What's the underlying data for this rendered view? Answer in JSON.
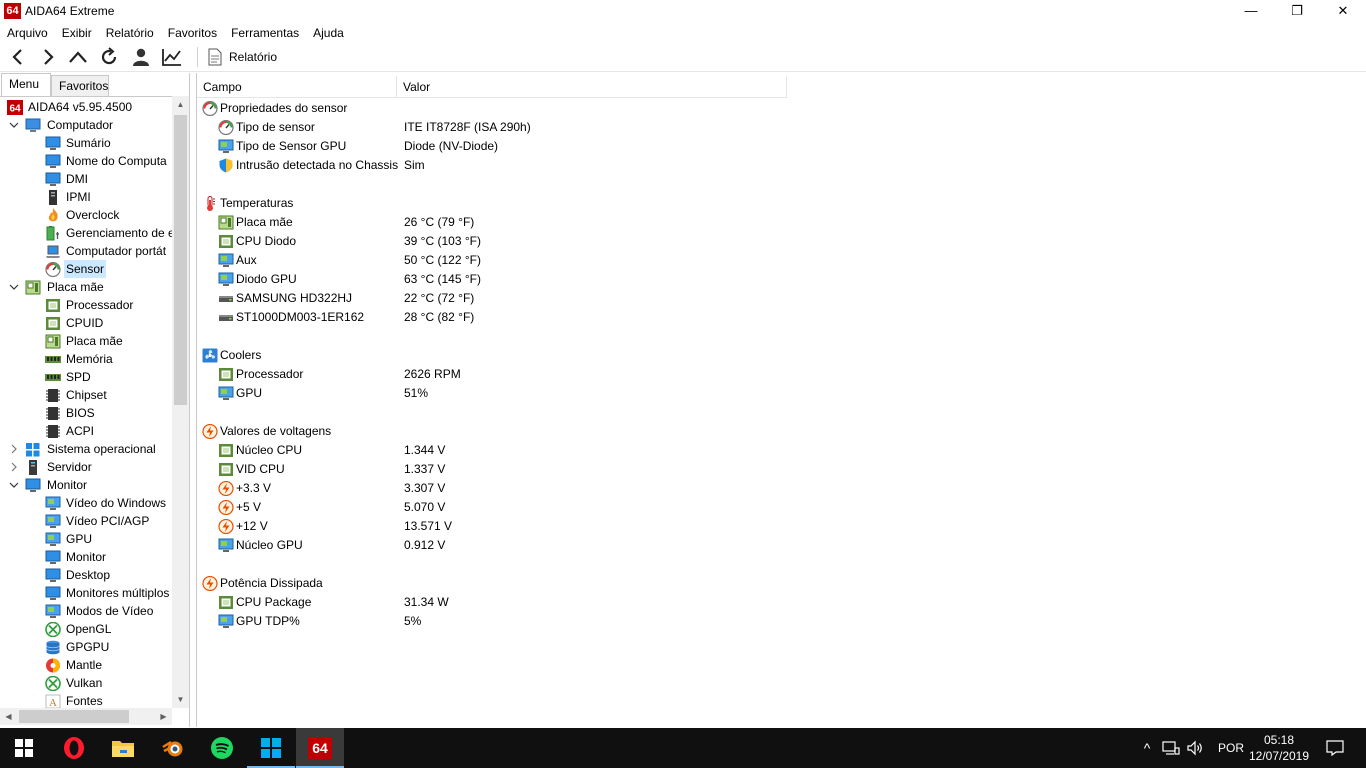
{
  "window": {
    "logo_text": "64",
    "title": "AIDA64 Extreme",
    "minimize": "—",
    "maximize": "❐",
    "close": "✕"
  },
  "menubar": [
    "Arquivo",
    "Exibir",
    "Relatório",
    "Favoritos",
    "Ferramentas",
    "Ajuda"
  ],
  "toolbar": {
    "buttons": [
      "back-icon",
      "forward-icon",
      "up-icon",
      "refresh-icon",
      "user-icon",
      "chart-icon"
    ],
    "report_label": "Relatório"
  },
  "left_tabs": {
    "menu": "Menu",
    "favorites": "Favoritos"
  },
  "tree": [
    {
      "label": "AIDA64 v5.95.4500",
      "level": 0,
      "expander": "",
      "icon": "aida64-icon"
    },
    {
      "label": "Computador",
      "level": 1,
      "expander": "v",
      "icon": "computer-icon"
    },
    {
      "label": "Sumário",
      "level": 2,
      "expander": "",
      "icon": "monitor-icon"
    },
    {
      "label": "Nome do Computa",
      "level": 2,
      "expander": "",
      "icon": "monitor-icon"
    },
    {
      "label": "DMI",
      "level": 2,
      "expander": "",
      "icon": "monitor-icon"
    },
    {
      "label": "IPMI",
      "level": 2,
      "expander": "",
      "icon": "tower-icon"
    },
    {
      "label": "Overclock",
      "level": 2,
      "expander": "",
      "icon": "flame-icon"
    },
    {
      "label": "Gerenciamento de e",
      "level": 2,
      "expander": "",
      "icon": "battery-icon"
    },
    {
      "label": "Computador portát",
      "level": 2,
      "expander": "",
      "icon": "laptop-icon"
    },
    {
      "label": "Sensor",
      "level": 2,
      "expander": "",
      "icon": "sensor-icon",
      "selected": true
    },
    {
      "label": "Placa mãe",
      "level": 1,
      "expander": "v",
      "icon": "motherboard-icon"
    },
    {
      "label": "Processador",
      "level": 2,
      "expander": "",
      "icon": "chip-icon"
    },
    {
      "label": "CPUID",
      "level": 2,
      "expander": "",
      "icon": "chip-icon"
    },
    {
      "label": "Placa mãe",
      "level": 2,
      "expander": "",
      "icon": "motherboard-icon"
    },
    {
      "label": "Memória",
      "level": 2,
      "expander": "",
      "icon": "ram-icon"
    },
    {
      "label": "SPD",
      "level": 2,
      "expander": "",
      "icon": "ram-icon"
    },
    {
      "label": "Chipset",
      "level": 2,
      "expander": "",
      "icon": "ic-icon"
    },
    {
      "label": "BIOS",
      "level": 2,
      "expander": "",
      "icon": "ic-icon"
    },
    {
      "label": "ACPI",
      "level": 2,
      "expander": "",
      "icon": "ic-icon"
    },
    {
      "label": "Sistema operacional",
      "level": 1,
      "expander": ">",
      "icon": "windows-icon"
    },
    {
      "label": "Servidor",
      "level": 1,
      "expander": ">",
      "icon": "server-icon"
    },
    {
      "label": "Monitor",
      "level": 1,
      "expander": "v",
      "icon": "monitor-icon"
    },
    {
      "label": "Vídeo do Windows",
      "level": 2,
      "expander": "",
      "icon": "display-icon"
    },
    {
      "label": "Vídeo PCI/AGP",
      "level": 2,
      "expander": "",
      "icon": "display-icon"
    },
    {
      "label": "GPU",
      "level": 2,
      "expander": "",
      "icon": "display-icon"
    },
    {
      "label": "Monitor",
      "level": 2,
      "expander": "",
      "icon": "monitor-icon"
    },
    {
      "label": "Desktop",
      "level": 2,
      "expander": "",
      "icon": "monitor-icon"
    },
    {
      "label": "Monitores múltiplos",
      "level": 2,
      "expander": "",
      "icon": "monitor-icon"
    },
    {
      "label": "Modos de Vídeo",
      "level": 2,
      "expander": "",
      "icon": "display-icon"
    },
    {
      "label": "OpenGL",
      "level": 2,
      "expander": "",
      "icon": "xbox-icon"
    },
    {
      "label": "GPGPU",
      "level": 2,
      "expander": "",
      "icon": "database-icon"
    },
    {
      "label": "Mantle",
      "level": 2,
      "expander": "",
      "icon": "mantle-icon"
    },
    {
      "label": "Vulkan",
      "level": 2,
      "expander": "",
      "icon": "xbox-icon"
    },
    {
      "label": "Fontes",
      "level": 2,
      "expander": "",
      "icon": "font-icon"
    }
  ],
  "columns": {
    "field": "Campo",
    "value": "Valor"
  },
  "sections": [
    {
      "title": "Propriedades do sensor",
      "icon": "sensor-icon",
      "rows": [
        {
          "field": "Tipo de sensor",
          "value": "ITE IT8728F  (ISA 290h)",
          "icon": "sensor-icon"
        },
        {
          "field": "Tipo de Sensor GPU",
          "value": "Diode  (NV-Diode)",
          "icon": "display-icon"
        },
        {
          "field": "Intrusão detectada no Chassis",
          "value": "Sim",
          "icon": "shield-icon"
        }
      ]
    },
    {
      "title": "Temperaturas",
      "icon": "thermometer-icon",
      "rows": [
        {
          "field": "Placa mãe",
          "value": "26 °C  (79 °F)",
          "icon": "motherboard-icon"
        },
        {
          "field": "CPU Diodo",
          "value": "39 °C  (103 °F)",
          "icon": "chip-icon"
        },
        {
          "field": "Aux",
          "value": "50 °C  (122 °F)",
          "icon": "display-icon"
        },
        {
          "field": "Diodo GPU",
          "value": "63 °C  (145 °F)",
          "icon": "display-icon"
        },
        {
          "field": "SAMSUNG HD322HJ",
          "value": "22 °C  (72 °F)",
          "icon": "hdd-icon"
        },
        {
          "field": "ST1000DM003-1ER162",
          "value": "28 °C  (82 °F)",
          "icon": "hdd-icon"
        }
      ]
    },
    {
      "title": "Coolers",
      "icon": "fan-icon",
      "rows": [
        {
          "field": "Processador",
          "value": "2626 RPM",
          "icon": "chip-icon"
        },
        {
          "field": "GPU",
          "value": "51%",
          "icon": "display-icon"
        }
      ]
    },
    {
      "title": "Valores de voltagens",
      "icon": "bolt-icon",
      "rows": [
        {
          "field": "Núcleo CPU",
          "value": "1.344 V",
          "icon": "chip-icon"
        },
        {
          "field": "VID CPU",
          "value": "1.337 V",
          "icon": "chip-icon"
        },
        {
          "field": "+3.3 V",
          "value": "3.307 V",
          "icon": "bolt-icon"
        },
        {
          "field": "+5 V",
          "value": "5.070 V",
          "icon": "bolt-icon"
        },
        {
          "field": "+12 V",
          "value": "13.571 V",
          "icon": "bolt-icon"
        },
        {
          "field": "Núcleo GPU",
          "value": "0.912 V",
          "icon": "display-icon"
        }
      ]
    },
    {
      "title": "Potência Dissipada",
      "icon": "bolt-icon",
      "rows": [
        {
          "field": "CPU Package",
          "value": "31.34 W",
          "icon": "chip-icon"
        },
        {
          "field": "GPU TDP%",
          "value": "5%",
          "icon": "display-icon"
        }
      ]
    }
  ],
  "taskbar": {
    "apps": [
      "windows-start-icon",
      "opera-icon",
      "file-explorer-icon",
      "blender-icon",
      "spotify-icon",
      "windows-store-icon",
      "aida64-taskbar-icon"
    ],
    "aida_label": "64",
    "language": "POR",
    "time": "05:18",
    "date": "12/07/2019",
    "tray_expand": "^"
  },
  "colors": {
    "accent_blue": "#0078d7",
    "selection": "#cce8ff",
    "aida_red": "#c00000",
    "taskbar": "#101010"
  }
}
